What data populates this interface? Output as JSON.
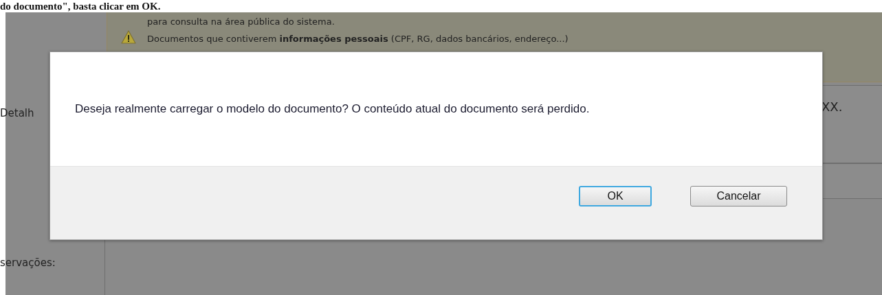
{
  "top_line": "do documento\", basta clicar em OK.",
  "notice": {
    "lines": [
      "para consulta na área pública do sistema.",
      "Documentos que contiverem **informações pessoais** (CPF, RG, dados bancários, endereço...)"
    ]
  },
  "form": {
    "details_label": "Detalh",
    "details_value": "XX.",
    "observations_label": "servações:"
  },
  "dialog": {
    "message": "Deseja realmente carregar o modelo do documento? O conteúdo atual do documento será perdido.",
    "buttons": [
      {
        "label": "OK",
        "focused": true
      },
      {
        "label": "Cancelar",
        "focused": false
      }
    ]
  }
}
